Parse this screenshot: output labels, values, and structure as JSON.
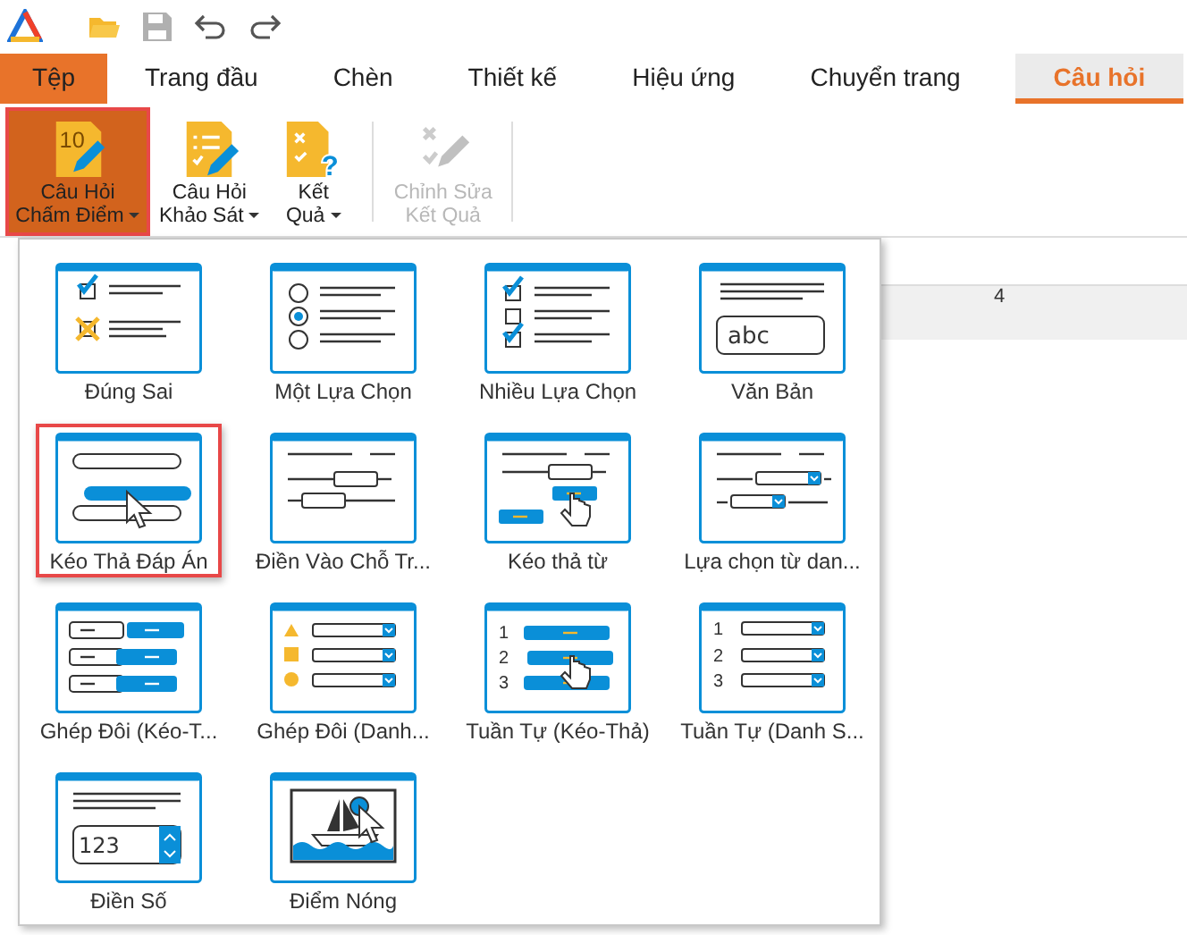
{
  "toolbar": {
    "items": [
      {
        "kind": "logo"
      },
      {
        "kind": "open"
      },
      {
        "kind": "save",
        "disabled": true
      },
      {
        "kind": "undo",
        "disabled": false
      },
      {
        "kind": "redo",
        "disabled": false
      }
    ]
  },
  "tabs": [
    {
      "label": "Tệp",
      "kind": "file",
      "selected": false
    },
    {
      "label": "Trang đầu",
      "kind": "tab",
      "selected": false
    },
    {
      "label": "Chèn",
      "kind": "tab",
      "selected": false
    },
    {
      "label": "Thiết kế",
      "kind": "tab",
      "selected": false
    },
    {
      "label": "Hiệu ứng",
      "kind": "tab",
      "selected": false
    },
    {
      "label": "Chuyển trang",
      "kind": "tab",
      "selected": false
    },
    {
      "label": "Câu hỏi",
      "kind": "tab",
      "selected": true
    }
  ],
  "ribbon": [
    {
      "lines": [
        "Câu Hỏi",
        "Chấm Điểm"
      ],
      "kind": "graded",
      "icon_text": "10",
      "has_menu": true,
      "selected": true,
      "disabled": false
    },
    {
      "lines": [
        "Câu Hỏi",
        "Khảo Sát"
      ],
      "kind": "survey",
      "has_menu": true,
      "selected": false,
      "disabled": false
    },
    {
      "lines": [
        "Kết",
        "Quả"
      ],
      "kind": "result",
      "icon_text": "?",
      "has_menu": true,
      "selected": false,
      "disabled": false
    },
    {
      "lines": [
        "Chỉnh Sửa",
        "Kết Quả"
      ],
      "kind": "edit_result",
      "has_menu": false,
      "selected": false,
      "disabled": true
    }
  ],
  "ruler": {
    "labels": [
      "4"
    ]
  },
  "question_types": [
    {
      "label": "Đúng Sai",
      "kind": "true_false",
      "selected": false
    },
    {
      "label": "Một Lựa Chọn",
      "kind": "single_choice",
      "selected": false
    },
    {
      "label": "Nhiều Lựa Chọn",
      "kind": "multiple_choice",
      "selected": false
    },
    {
      "label": "Văn Bản",
      "kind": "text",
      "icon_text": [
        "abc"
      ],
      "selected": false
    },
    {
      "label": "Kéo Thả Đáp Án",
      "kind": "drag_answer",
      "selected": true
    },
    {
      "label": "Điền Vào Chỗ Tr...",
      "kind": "fill_blank",
      "selected": false
    },
    {
      "label": "Kéo thả từ",
      "kind": "drag_words",
      "selected": false
    },
    {
      "label": "Lựa chọn từ dan...",
      "kind": "dropdown_words",
      "selected": false
    },
    {
      "label": "Ghép Đôi (Kéo-T...",
      "kind": "match_drag",
      "selected": false
    },
    {
      "label": "Ghép Đôi (Danh...",
      "kind": "match_list",
      "selected": false
    },
    {
      "label": "Tuần Tự (Kéo-Thả)",
      "kind": "sequence_drag",
      "icon_text": [
        "1",
        "2",
        "3"
      ],
      "selected": false
    },
    {
      "label": "Tuần Tự (Danh S...",
      "kind": "sequence_list",
      "icon_text": [
        "1",
        "2",
        "3"
      ],
      "selected": false
    },
    {
      "label": "Điền Số",
      "kind": "numeric",
      "icon_text": [
        "123"
      ],
      "selected": false
    },
    {
      "label": "Điểm Nóng",
      "kind": "hotspot",
      "selected": false
    }
  ]
}
